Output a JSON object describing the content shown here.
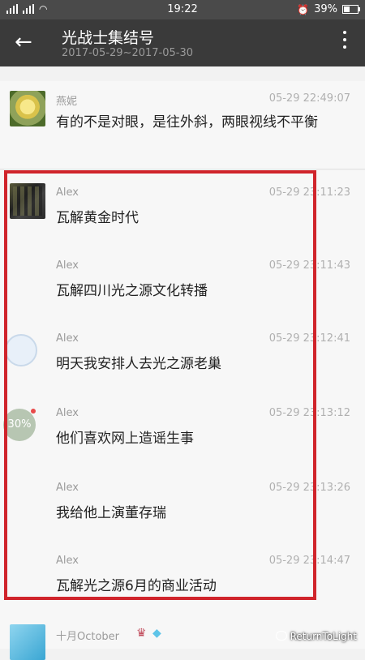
{
  "status_bar": {
    "time": "19:22",
    "battery": "39%",
    "battery_level": 0.39
  },
  "header": {
    "title": "光战士集结号",
    "subtitle": "2017-05-29~2017-05-30"
  },
  "messages": [
    {
      "name": "燕妮",
      "time": "05-29 22:49:07",
      "text": "有的不是对眼，是往外斜，两眼视线不平衡"
    },
    {
      "name": "Alex",
      "time": "05-29 23:11:23",
      "text": "瓦解黄金时代"
    },
    {
      "name": "Alex",
      "time": "05-29 23:11:43",
      "text": "瓦解四川光之源文化转播"
    },
    {
      "name": "Alex",
      "time": "05-29 23:12:41",
      "text": "明天我安排人去光之源老巢"
    },
    {
      "name": "Alex",
      "time": "05-29 23:13:12",
      "text": "他们喜欢网上造谣生事"
    },
    {
      "name": "Alex",
      "time": "05-29 23:13:26",
      "text": "我给他上演董存瑞"
    },
    {
      "name": "Alex",
      "time": "05-29 23:14:47",
      "text": "瓦解光之源6月的商业活动"
    },
    {
      "name": "十月October",
      "time": "",
      "text": ""
    }
  ],
  "avatar_badge_text": "30%",
  "watermark": "ReturnToLight",
  "accent_color": "#d0242b"
}
